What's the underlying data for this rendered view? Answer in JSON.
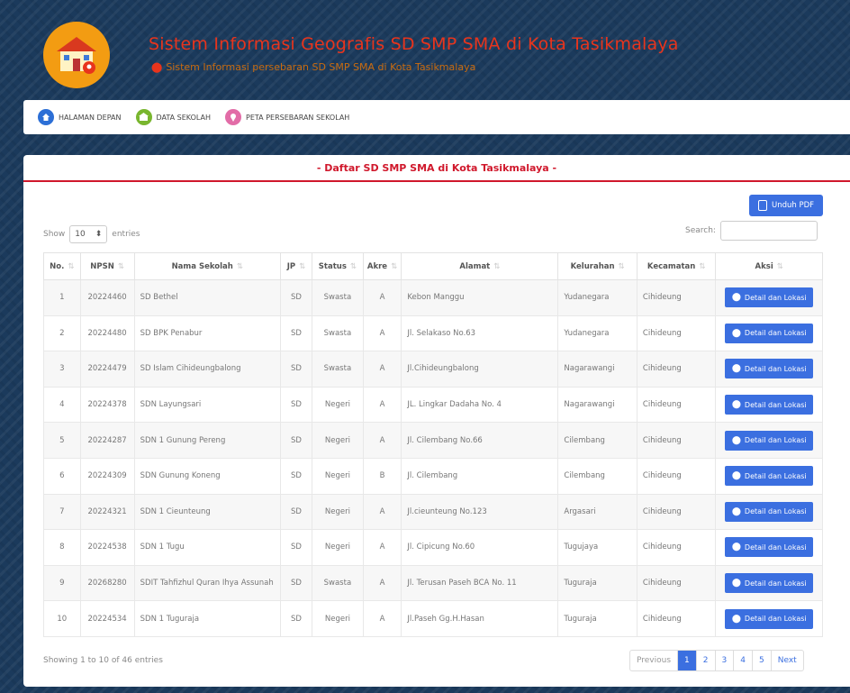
{
  "header": {
    "title": "Sistem Informasi Geografis SD SMP SMA di Kota Tasikmalaya",
    "subtitle": "Sistem Informasi persebaran SD SMP SMA di Kota Tasikmalaya"
  },
  "nav": [
    {
      "label": "HALAMAN DEPAN",
      "icon": "home-icon",
      "color": "#2c6fd6"
    },
    {
      "label": "DATA SEKOLAH",
      "icon": "school-icon",
      "color": "#79b62f"
    },
    {
      "label": "PETA PERSEBARAN SEKOLAH",
      "icon": "map-icon",
      "color": "#e26ca7"
    }
  ],
  "panel": {
    "title": "- Daftar SD SMP SMA di Kota Tasikmalaya -",
    "pdf_button": "Unduh PDF",
    "show_label": "Show",
    "show_value": "10",
    "entries_label": "entries",
    "search_label": "Search:"
  },
  "table": {
    "columns": [
      "No.",
      "NPSN",
      "Nama Sekolah",
      "JP",
      "Status",
      "Akre",
      "Alamat",
      "Kelurahan",
      "Kecamatan",
      "Aksi"
    ],
    "action_label": "Detail dan Lokasi",
    "rows": [
      [
        "1",
        "20224460",
        "SD Bethel",
        "SD",
        "Swasta",
        "A",
        "Kebon Manggu",
        "Yudanegara",
        "Cihideung"
      ],
      [
        "2",
        "20224480",
        "SD BPK Penabur",
        "SD",
        "Swasta",
        "A",
        "Jl. Selakaso No.63",
        "Yudanegara",
        "Cihideung"
      ],
      [
        "3",
        "20224479",
        "SD Islam Cihideungbalong",
        "SD",
        "Swasta",
        "A",
        "Jl.Cihideungbalong",
        "Nagarawangi",
        "Cihideung"
      ],
      [
        "4",
        "20224378",
        "SDN Layungsari",
        "SD",
        "Negeri",
        "A",
        "JL. Lingkar Dadaha No. 4",
        "Nagarawangi",
        "Cihideung"
      ],
      [
        "5",
        "20224287",
        "SDN 1 Gunung Pereng",
        "SD",
        "Negeri",
        "A",
        "Jl. Cilembang No.66",
        "Cilembang",
        "Cihideung"
      ],
      [
        "6",
        "20224309",
        "SDN Gunung Koneng",
        "SD",
        "Negeri",
        "B",
        "Jl. Cilembang",
        "Cilembang",
        "Cihideung"
      ],
      [
        "7",
        "20224321",
        "SDN 1 Cieunteung",
        "SD",
        "Negeri",
        "A",
        "Jl.cieunteung No.123",
        "Argasari",
        "Cihideung"
      ],
      [
        "8",
        "20224538",
        "SDN 1 Tugu",
        "SD",
        "Negeri",
        "A",
        "Jl. Cipicung No.60",
        "Tugujaya",
        "Cihideung"
      ],
      [
        "9",
        "20268280",
        "SDIT Tahfizhul Quran Ihya Assunah",
        "SD",
        "Swasta",
        "A",
        "Jl. Terusan Paseh BCA No. 11",
        "Tuguraja",
        "Cihideung"
      ],
      [
        "10",
        "20224534",
        "SDN 1 Tuguraja",
        "SD",
        "Negeri",
        "A",
        "Jl.Paseh Gg.H.Hasan",
        "Tuguraja",
        "Cihideung"
      ]
    ]
  },
  "footer": {
    "info": "Showing 1 to 10 of 46 entries",
    "pages": [
      "Previous",
      "1",
      "2",
      "3",
      "4",
      "5",
      "Next"
    ],
    "active_page": "1"
  },
  "colors": {
    "accent": "#3b6fe0",
    "title_red": "#e8341c",
    "panel_title": "#d0182c"
  }
}
